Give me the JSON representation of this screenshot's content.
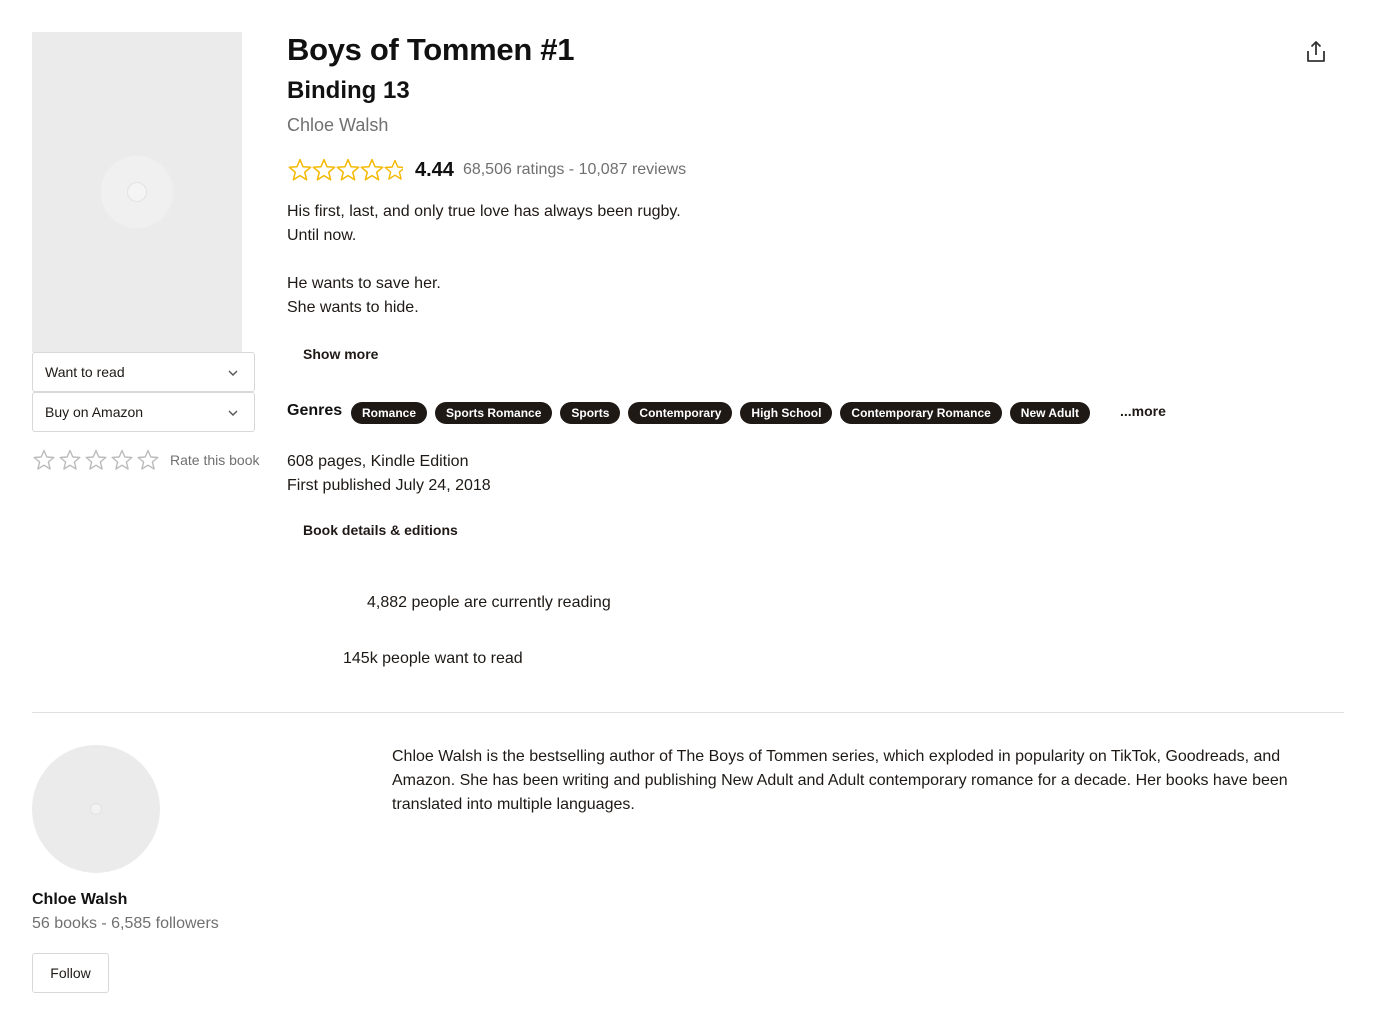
{
  "book": {
    "title": "Boys of Tommen #1",
    "subtitle": "Binding 13",
    "author": "Chloe Walsh",
    "rating_avg": "4.44",
    "rating_value": 4.44,
    "rating_meta": "68,506 ratings - 10,087 reviews",
    "description": [
      "His first, last, and only true love has always been rugby.",
      "Until now.",
      "",
      "He wants to save her.",
      "She wants to hide."
    ],
    "show_more": "Show more",
    "genres_label": "Genres",
    "genres": [
      "Romance",
      "Sports Romance",
      "Sports",
      "Contemporary",
      "High School",
      "Contemporary Romance",
      "New Adult"
    ],
    "genres_more": "...more",
    "pages_format": "608 pages, Kindle Edition",
    "first_published": "First published July 24, 2018",
    "details_link": "Book details & editions",
    "currently_reading": "4,882 people are currently reading",
    "want_to_read_count": "145k people want to read"
  },
  "actions": {
    "want_to_read": "Want to read",
    "buy": "Buy on Amazon",
    "rate_this_book": "Rate this book",
    "share_icon": "share-icon"
  },
  "author_section": {
    "name": "Chloe Walsh",
    "meta": "56 books - 6,585 followers",
    "follow": "Follow",
    "bio": "Chloe Walsh is the bestselling author of The Boys of Tommen series, which exploded in popularity on TikTok, Goodreads, and Amazon. She has been writing and publishing New Adult and Adult contemporary romance for a decade. Her books have been translated into multiple languages."
  },
  "colors": {
    "star_fill": "#f5b800",
    "star_empty": "#bbbbbb",
    "chip_bg": "#1e1915",
    "muted_text": "#707070"
  }
}
